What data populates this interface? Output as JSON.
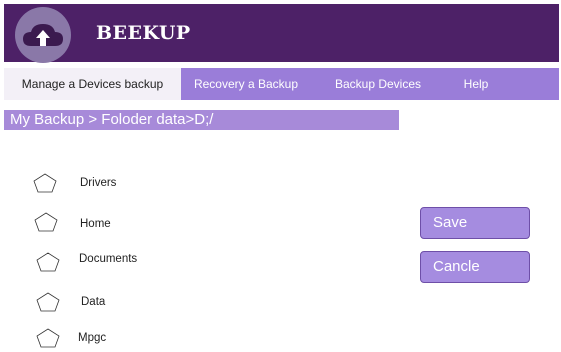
{
  "header": {
    "brand": "BEEKUP",
    "logo_icon": "cloud-upload-icon",
    "bg_color": "#4d2167"
  },
  "tabs": [
    {
      "label": "Manage a Devices backup",
      "active": true
    },
    {
      "label": "Recovery a Backup",
      "active": false
    },
    {
      "label": "Backup Devices",
      "active": false
    },
    {
      "label": "Help",
      "active": false
    }
  ],
  "breadcrumb": "My Backup > Foloder data>D;/",
  "folders": [
    {
      "label": "Drivers",
      "icon": "pentagon-icon"
    },
    {
      "label": "Home",
      "icon": "pentagon-icon"
    },
    {
      "label": "Documents",
      "icon": "pentagon-icon"
    },
    {
      "label": "Data",
      "icon": "pentagon-icon"
    },
    {
      "label": "Mpgc",
      "icon": "pentagon-icon"
    }
  ],
  "buttons": {
    "save_label": "Save",
    "cancel_label": "Cancle"
  },
  "colors": {
    "accent": "#9a7dd9",
    "button": "#a58ce0"
  }
}
